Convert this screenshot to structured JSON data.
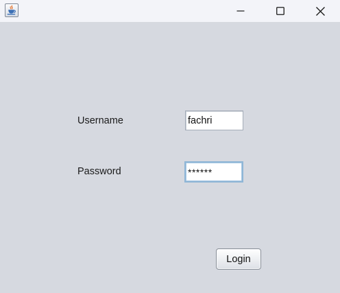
{
  "titlebar": {
    "icon": "java-coffee-icon",
    "controls": [
      "minimize-icon",
      "maximize-icon",
      "close-icon"
    ]
  },
  "form": {
    "username_label": "Username",
    "username_value": "fachri",
    "password_label": "Password",
    "password_value": "******",
    "login_label": "Login"
  },
  "colors": {
    "titlebar": "#f3f4f9",
    "window_background": "#d6d9e0",
    "focus_border": "#8fb6d6"
  }
}
